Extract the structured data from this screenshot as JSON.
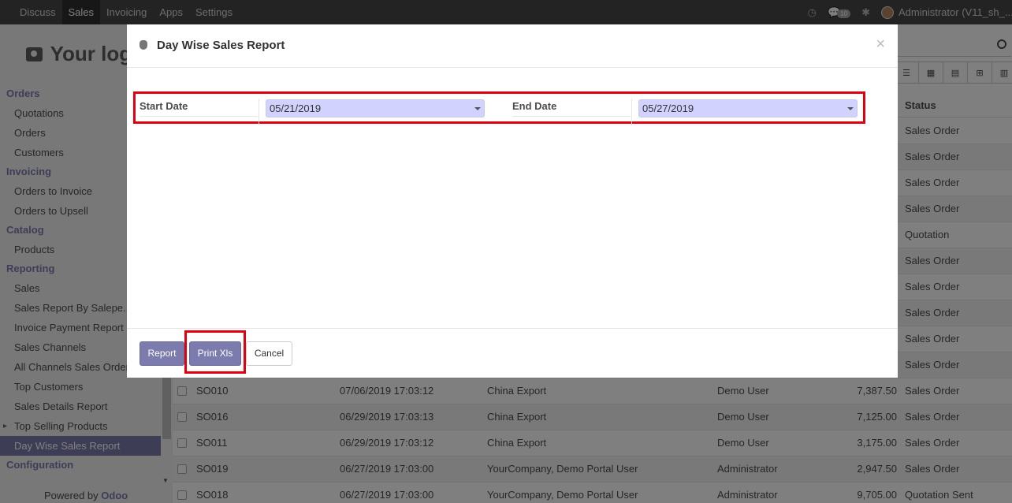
{
  "navbar": {
    "items": [
      "Discuss",
      "Sales",
      "Invoicing",
      "Apps",
      "Settings"
    ],
    "active": "Sales",
    "message_count": "10",
    "user": "Administrator (V11_sh_..."
  },
  "sidebar": {
    "logo_text": "Your logo",
    "sections": [
      {
        "title": "Orders",
        "items": [
          "Quotations",
          "Orders",
          "Customers"
        ]
      },
      {
        "title": "Invoicing",
        "items": [
          "Orders to Invoice",
          "Orders to Upsell"
        ]
      },
      {
        "title": "Catalog",
        "items": [
          "Products"
        ]
      },
      {
        "title": "Reporting",
        "items": [
          "Sales",
          "Sales Report By Salepe...",
          "Invoice Payment Report",
          "Sales Channels",
          "All Channels Sales Orders",
          "Top Customers",
          "Sales Details Report",
          "Top Selling Products",
          "Day Wise Sales Report"
        ]
      },
      {
        "title": "Configuration",
        "items": []
      }
    ],
    "active_item": "Day Wise Sales Report",
    "powered_prefix": "Powered by",
    "powered_brand": "Odoo"
  },
  "list": {
    "status_header": "Status",
    "hidden_statuses": [
      "Sales Order",
      "Sales Order",
      "Sales Order",
      "Sales Order",
      "Quotation",
      "Sales Order",
      "Sales Order",
      "Sales Order",
      "Sales Order",
      "Sales Order"
    ],
    "rows": [
      {
        "number": "SO010",
        "date": "07/06/2019 17:03:12",
        "customer": "China Export",
        "salesperson": "Demo User",
        "total": "7,387.50",
        "status": "Sales Order"
      },
      {
        "number": "SO016",
        "date": "06/29/2019 17:03:13",
        "customer": "China Export",
        "salesperson": "Demo User",
        "total": "7,125.00",
        "status": "Sales Order"
      },
      {
        "number": "SO011",
        "date": "06/29/2019 17:03:12",
        "customer": "China Export",
        "salesperson": "Demo User",
        "total": "3,175.00",
        "status": "Sales Order"
      },
      {
        "number": "SO019",
        "date": "06/27/2019 17:03:00",
        "customer": "YourCompany, Demo Portal User",
        "salesperson": "Administrator",
        "total": "2,947.50",
        "status": "Sales Order"
      },
      {
        "number": "SO018",
        "date": "06/27/2019 17:03:00",
        "customer": "YourCompany, Demo Portal User",
        "salesperson": "Administrator",
        "total": "9,705.00",
        "status": "Quotation Sent"
      }
    ]
  },
  "dialog": {
    "title": "Day Wise Sales Report",
    "close": "×",
    "start_label": "Start Date",
    "start_value": "05/21/2019",
    "end_label": "End Date",
    "end_value": "05/27/2019",
    "buttons": {
      "report": "Report",
      "print": "Print Xls",
      "cancel": "Cancel"
    }
  }
}
